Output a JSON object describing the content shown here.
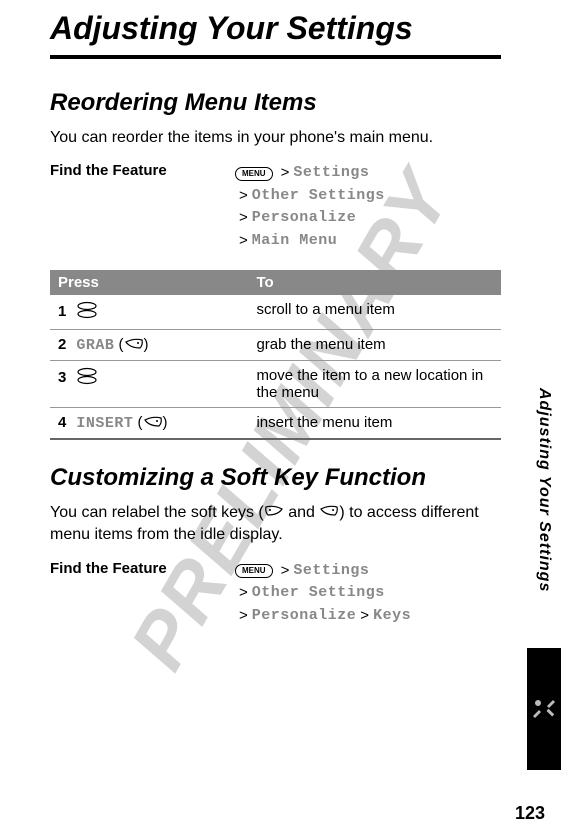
{
  "watermark": "PRELIMINARY",
  "chapter_title": "Adjusting Your Settings",
  "section1": {
    "title": "Reordering Menu Items",
    "intro": "You can reorder the items in your phone's main menu.",
    "feature_label": "Find the Feature",
    "menu_label": "MENU",
    "path": [
      "Settings",
      "Other Settings",
      "Personalize",
      "Main Menu"
    ]
  },
  "table": {
    "head_press": "Press",
    "head_to": "To",
    "rows": [
      {
        "n": "1",
        "press_type": "scroll",
        "press_text": "",
        "to": "scroll to a menu item"
      },
      {
        "n": "2",
        "press_type": "softkey-right",
        "press_text": "GRAB",
        "to": "grab the menu item"
      },
      {
        "n": "3",
        "press_type": "scroll",
        "press_text": "",
        "to": "move the item to a new location in the menu"
      },
      {
        "n": "4",
        "press_type": "softkey-right",
        "press_text": "INSERT",
        "to": "insert the menu item"
      }
    ]
  },
  "section2": {
    "title": "Customizing a Soft Key Function",
    "intro_prefix": "You can relabel the soft keys (",
    "intro_mid": " and ",
    "intro_suffix": ") to access different menu items from the idle display.",
    "feature_label": "Find the Feature",
    "menu_label": "MENU",
    "path_lines": [
      [
        "Settings"
      ],
      [
        "Other Settings"
      ],
      [
        "Personalize",
        "Keys"
      ]
    ]
  },
  "side_tab": "Adjusting Your Settings",
  "page_number": "123"
}
